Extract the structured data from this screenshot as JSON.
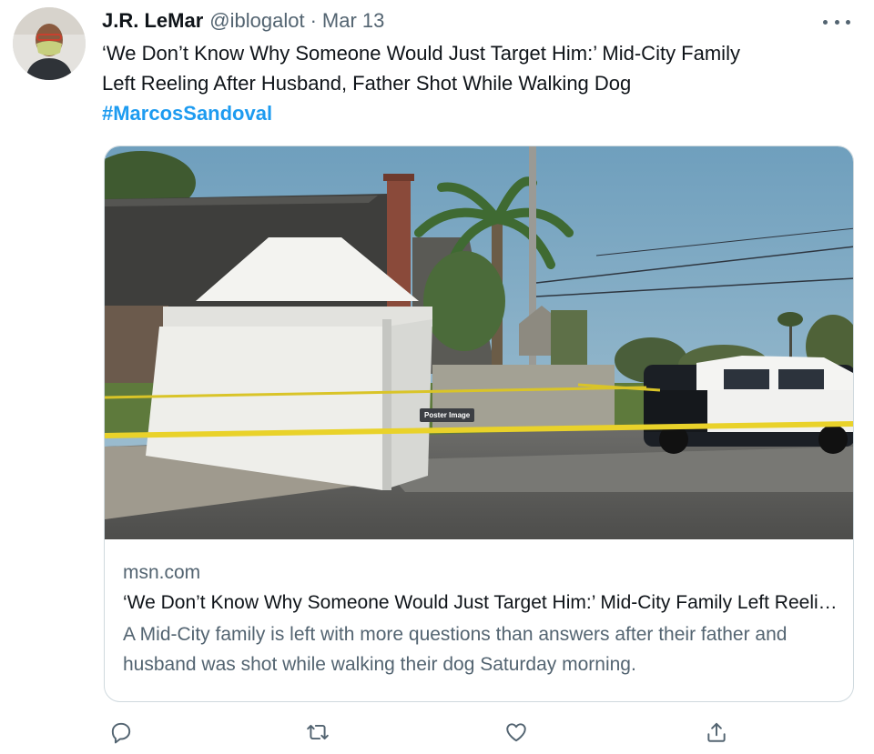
{
  "tweet": {
    "author_name": "J.R. LeMar",
    "handle": "@iblogalot",
    "separator": "·",
    "date": "Mar 13",
    "text_line1": "‘We Don’t Know Why Someone Would Just Target Him:’ Mid-City Family",
    "text_line2": "Left Reeling After Husband, Father Shot While Walking Dog",
    "hashtag": "#MarcosSandoval"
  },
  "card": {
    "image_tag": "Poster Image",
    "domain": "msn.com",
    "title": "‘We Don’t Know Why Someone Would Just Target Him:’ Mid-City Family Left Reeling After Husband, Father Shot While Walking Dog",
    "description": "A Mid-City family is left with more questions than answers after their father and husband was shot while walking their dog Saturday morning."
  },
  "actions": {
    "reply_icon": "reply-icon",
    "retweet_icon": "retweet-icon",
    "like_icon": "heart-icon",
    "share_icon": "share-icon"
  },
  "colors": {
    "link": "#1d9bf0",
    "secondary_text": "#536471",
    "border": "#cfd9de"
  }
}
